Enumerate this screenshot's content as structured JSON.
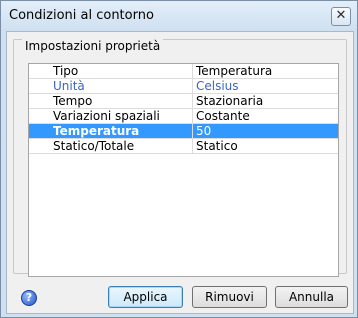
{
  "window": {
    "title": "Condizioni al contorno",
    "close_glyph": "✕",
    "close_icon": "close-icon"
  },
  "group": {
    "title": "Impostazioni proprietà"
  },
  "properties": {
    "rows": [
      {
        "key": "Tipo",
        "value": "Temperatura"
      },
      {
        "key": "Unità",
        "value": "Celsius"
      },
      {
        "key": "Tempo",
        "value": "Stazionaria"
      },
      {
        "key": "Variazioni spaziali",
        "value": "Costante"
      },
      {
        "key": "Temperatura",
        "value": "50"
      },
      {
        "key": "Statico/Totale",
        "value": "Statico"
      }
    ],
    "selected_row": 4,
    "link_color": "#3c63c7",
    "selection_color": "#3399ff"
  },
  "buttons": {
    "apply": "Applica",
    "remove": "Rimuovi",
    "cancel": "Annulla"
  },
  "help": {
    "glyph": "?",
    "icon": "help-icon"
  }
}
